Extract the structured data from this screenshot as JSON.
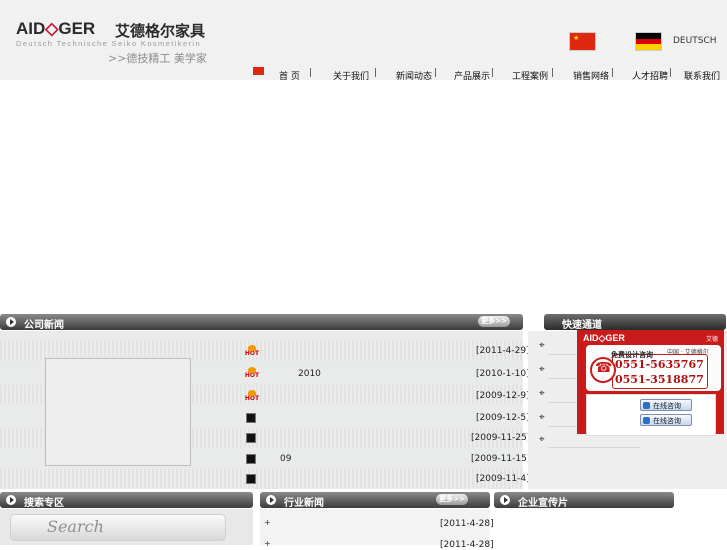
{
  "header": {
    "brand_pre": "AID",
    "brand_mid": "◇",
    "brand_post": "GER",
    "brand_cn": "艾德格尔家具",
    "tagline": "Deutsch Technische Seiko Kosmetikerin",
    "slogan": ">>德技精工 美学家",
    "lang_de": "DEUTSCH"
  },
  "nav": {
    "items": [
      "首 页",
      "关于我们",
      "新闻动态",
      "产品展示",
      "工程案例",
      "销售网络",
      "人才招聘",
      "联系我们"
    ]
  },
  "company_news": {
    "title": "公司新闻",
    "more": "更多>>",
    "items": [
      {
        "title": "",
        "date": "[2011-4-29]",
        "tag": "HOT"
      },
      {
        "title": "2010",
        "date": "[2010-1-10]",
        "tag": "HOT"
      },
      {
        "title": "",
        "date": "[2009-12-9]",
        "tag": "HOT"
      },
      {
        "title": "",
        "date": "[2009-12-5]",
        "tag": ""
      },
      {
        "title": "",
        "date": "[2009-11-25]",
        "tag": ""
      },
      {
        "title": "09",
        "date": "[2009-11-15]",
        "tag": ""
      },
      {
        "title": "",
        "date": "[2009-11-4]",
        "tag": ""
      }
    ]
  },
  "quick_links": {
    "title": "快速通道",
    "consult": {
      "logo": "AID◇GER",
      "corner": "艾德",
      "brand": "中国 · 艾德格尔",
      "free": "免费设计咨询",
      "phone1": "0551-5635767",
      "phone2": "0551-3518877",
      "online1": "在线咨询",
      "online2": "在线咨询"
    }
  },
  "search": {
    "title": "搜索专区",
    "button": "Search"
  },
  "industry_news": {
    "title": "行业新闻",
    "more": "更多>>",
    "items": [
      {
        "date": "[2011-4-28]"
      },
      {
        "date": "[2011-4-28]"
      }
    ]
  },
  "promo": {
    "title": "企业宣传片"
  },
  "colors": {
    "accent_red": "#c81b1b",
    "bar_dark": "#3c3c3c"
  }
}
